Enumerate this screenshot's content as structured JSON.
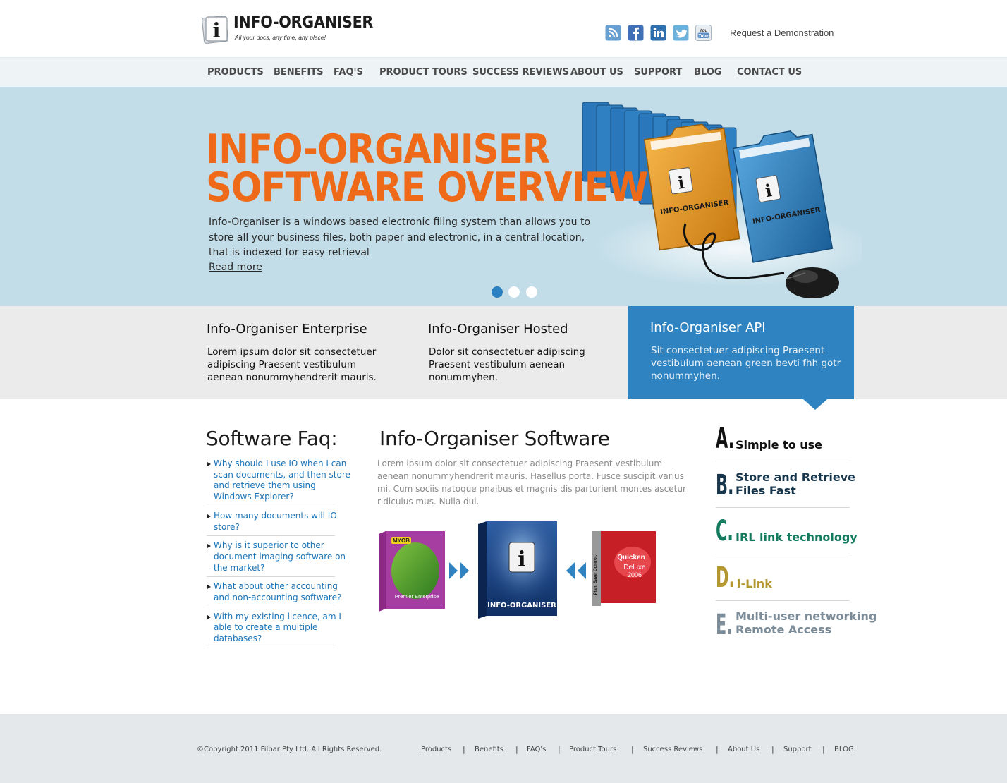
{
  "brand": {
    "name": "INFO-ORGANISER",
    "tagline": "All your docs, any time, any place!",
    "logo_letter": "i"
  },
  "social": [
    {
      "name": "RSS",
      "icon": "rss-icon",
      "color": "#5f97c8"
    },
    {
      "name": "Facebook",
      "icon": "facebook-icon",
      "color": "#3f6fb5"
    },
    {
      "name": "LinkedIn",
      "icon": "linkedin-icon",
      "color": "#2f6fae"
    },
    {
      "name": "Twitter",
      "icon": "twitter-icon",
      "color": "#6ab1dc"
    },
    {
      "name": "YouTube",
      "icon": "youtube-icon",
      "color": "#4f86c2",
      "text": "You Tube"
    }
  ],
  "header": {
    "demo_link": "Request a Demonstration"
  },
  "nav": [
    "PRODUCTS",
    "BENEFITS",
    "FAQ'S",
    "PRODUCT TOURS",
    "SUCCESS REVIEWS",
    "ABOUT US",
    "SUPPORT",
    "BLOG",
    "CONTACT US"
  ],
  "hero": {
    "title_line1": "INFO-ORGANISER",
    "title_line2": "SOFTWARE OVERVIEW",
    "text": "Info-Organiser is a windows based electronic filing system than allows you to store all your business files, both paper and electronic, in a central location, that is indexed for easy retrieval",
    "read_more": "Read more",
    "folder_label": "INFO-ORGANISER",
    "folder_letter": "i",
    "slides": 3,
    "active_slide": 1
  },
  "features": [
    {
      "title": "Info-Organiser Enterprise",
      "text": "Lorem ipsum dolor sit consectetuer adipiscing Praesent vestibulum aenean nonummyhendrerit mauris."
    },
    {
      "title": "Info-Organiser Hosted",
      "text": "Dolor sit consectetuer adipiscing Praesent vestibulum aenean nonummyhen."
    },
    {
      "title": "Info-Organiser API",
      "text": "Sit consectetuer adipiscing Praesent vestibulum aenean green bevti fhh gotr  nonummyhen."
    }
  ],
  "faq": {
    "heading": "Software Faq:",
    "items": [
      "Why should I use IO when I can scan documents, and then store and retrieve them using Windows Explorer?",
      "How many documents will IO store?",
      "Why is it superior to other document imaging software on the market?",
      "What about other accounting and non-accounting software?",
      "With my existing licence, am I able to create a multiple databases?"
    ]
  },
  "software": {
    "heading": "Info-Organiser Software",
    "text": "Lorem ipsum dolor sit consectetuer adipiscing Praesent vestibulum aenean nonummyhendrerit mauris. Hasellus porta. Fusce suscipit varius mi. Cum sociis natoque pnaibus et magnis dis parturient montes ascetur ridiculus mus. Nulla dui.",
    "box_left": {
      "brand": "MYOB",
      "product": "Premier Enterprise"
    },
    "box_center": {
      "name": "INFO-ORGANISER",
      "letter": "i"
    },
    "box_right": {
      "brand": "Quicken",
      "product": "Deluxe",
      "year": "2006",
      "spine": "Plan. Save. Control."
    }
  },
  "benefits": [
    {
      "letter": "A.",
      "label_lines": [
        "Simple to use"
      ],
      "color": "#111111"
    },
    {
      "letter": "B.",
      "label_lines": [
        "Store and Retrieve",
        "Files Fast"
      ],
      "color": "#17364c"
    },
    {
      "letter": "C.",
      "label_lines": [
        "IRL link technology"
      ],
      "color": "#137a5e"
    },
    {
      "letter": "D.",
      "label_lines": [
        "i-Link"
      ],
      "color": "#b3962e"
    },
    {
      "letter": "E.",
      "label_lines": [
        "Multi-user networking",
        "Remote Access"
      ],
      "color": "#7b8c98"
    }
  ],
  "footer": {
    "copyright": "©Copyright 2011 Filbar Pty Ltd. All Rights Reserved.",
    "links": [
      "Products",
      "Benefits",
      "FAQ's",
      "Product Tours",
      "Success Reviews",
      "About Us",
      "Support",
      "BLOG"
    ]
  },
  "colors": {
    "accent_orange": "#ee6a18",
    "accent_blue": "#2f83c0",
    "hero_bg": "#c2dde8",
    "link_blue": "#1a74b8"
  }
}
